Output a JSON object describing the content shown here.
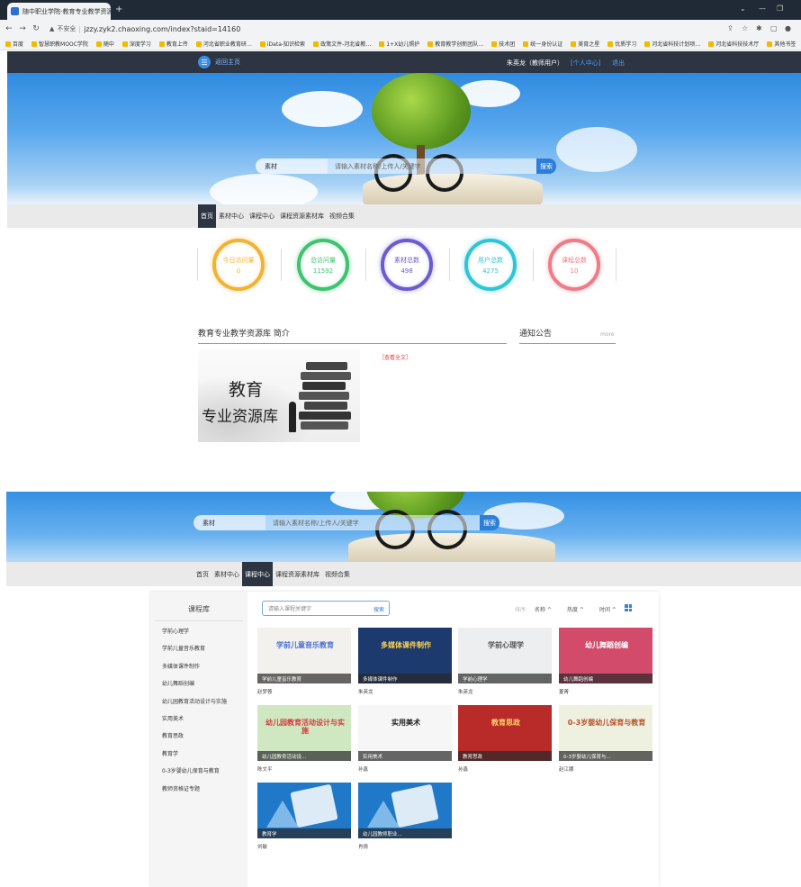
{
  "browser": {
    "tab_title": "随中职业学院-教育专业教学资源…",
    "url": "jzzy.zyk2.chaoxing.com/index?staid=14160",
    "insecure_label": "不安全",
    "bookmarks": [
      "百度",
      "智慧职教MOOC学院",
      "随中",
      "深度学习",
      "教育上传",
      "河北省职业教育研…",
      "iData-知识检索",
      "政策文件-河北省教…",
      "1+X幼儿照护",
      "教育教学创新团队…",
      "技术团",
      "统一身份认证",
      "美育之星",
      "优质学习",
      "河北省科技计划项…",
      "河北省科技技术厅",
      "其他书签"
    ]
  },
  "header": {
    "home_label": "返回主页",
    "user": "朱英龙（教师用户）",
    "personal_center": "[个人中心]",
    "logout": "退出"
  },
  "banner": {
    "select_label": "素材",
    "placeholder": "请输入素材名称/上传人/关键字",
    "search_button": "搜索"
  },
  "nav": {
    "items": [
      "首页",
      "素材中心",
      "课程中心",
      "课程资源素材库",
      "视频合集"
    ]
  },
  "stats": [
    {
      "label": "今日访问量",
      "value": "0",
      "color": "#f2b233"
    },
    {
      "label": "总访问量",
      "value": "11592",
      "color": "#3ec36e"
    },
    {
      "label": "素材总数",
      "value": "498",
      "color": "#6b5bd1"
    },
    {
      "label": "用户总数",
      "value": "4275",
      "color": "#2ec5d6"
    },
    {
      "label": "课程总数",
      "value": "10",
      "color": "#f07a86"
    }
  ],
  "intro": {
    "title": "教育专业教学资源库 简介",
    "read_more": "［查看全文］",
    "image_text_1": "教育",
    "image_text_2": "专业资源库",
    "notice_title": "通知公告",
    "more": "more"
  },
  "course_library": {
    "title": "课程库",
    "categories": [
      "学前心理学",
      "学前儿童音乐教育",
      "多媒体课件制作",
      "幼儿舞蹈创编",
      "幼儿园教育活动设计与实施",
      "实用美术",
      "教育思政",
      "教育学",
      "0-3岁婴幼儿保育与教育",
      "教师资格证专题"
    ],
    "search_placeholder": "请输入课程关键字",
    "search_button": "搜索",
    "sort_label": "排序:",
    "sort_options": [
      "名称 ^",
      "热度 ^",
      "时间 ^"
    ],
    "courses": [
      {
        "caption": "学前儿童音乐教育",
        "author": "赵梦蓉",
        "title_art": "学前儿童音乐教育",
        "bg": "#f3f1ee",
        "fg": "#4a6fd0"
      },
      {
        "caption": "多媒体课件制作",
        "author": "朱英龙",
        "title_art": "多媒体课件制作",
        "bg": "#1d3a6e",
        "fg": "#ffd34d"
      },
      {
        "caption": "学前心理学",
        "author": "朱英龙",
        "title_art": "学前心理学",
        "bg": "#eceeef",
        "fg": "#555"
      },
      {
        "caption": "幼儿舞蹈创编",
        "author": "董菁",
        "title_art": "幼儿舞蹈创编",
        "bg": "#d24b6a",
        "fg": "#fff"
      },
      {
        "caption": "幼儿园教育活动设...",
        "author": "陈文平",
        "title_art": "幼儿园教育活动设计与实施",
        "bg": "#cfe8c2",
        "fg": "#d43b3b"
      },
      {
        "caption": "实用美术",
        "author": "孙鑫",
        "title_art": "实用美术",
        "bg": "#f6f6f6",
        "fg": "#222"
      },
      {
        "caption": "教育思政",
        "author": "孙鑫",
        "title_art": "教育思政",
        "bg": "#b82b28",
        "fg": "#ffd36b"
      },
      {
        "caption": "0-3岁婴幼儿保育与...",
        "author": "赵江娜",
        "title_art": "0-3岁婴幼儿保育与教育",
        "bg": "#eef0e0",
        "fg": "#b8532b"
      },
      {
        "caption": "教育学",
        "author": "刘敏",
        "title_art": "",
        "bg": "#1f78c8",
        "fg": "#fff"
      },
      {
        "caption": "幼儿园教师职业…",
        "author": "肖倩",
        "title_art": "",
        "bg": "#1f78c8",
        "fg": "#fff"
      }
    ]
  }
}
